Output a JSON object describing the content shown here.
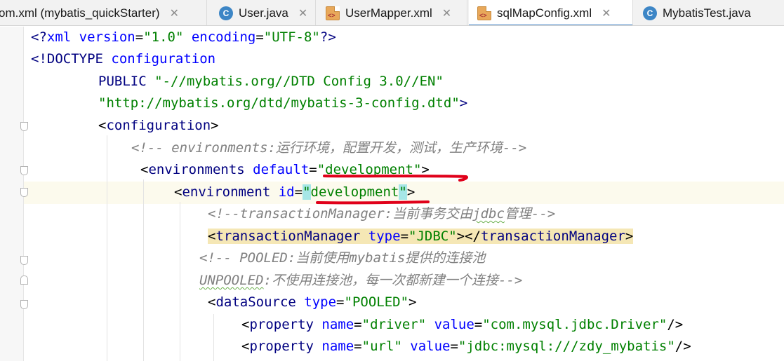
{
  "tabs": [
    {
      "label": "om.xml (mybatis_quickStarter)",
      "icon": "none",
      "active": false
    },
    {
      "label": "User.java",
      "icon": "java-class-icon",
      "active": false
    },
    {
      "label": "UserMapper.xml",
      "icon": "xml-file-icon",
      "active": false
    },
    {
      "label": "sqlMapConfig.xml",
      "icon": "xml-file-icon",
      "active": true
    },
    {
      "label": "MybatisTest.java",
      "icon": "java-class-icon",
      "active": false
    }
  ],
  "close_glyph": "✕",
  "code": {
    "l1": {
      "p1": "<?",
      "p2": "xml",
      "p3": " version",
      "p4": "=",
      "p5": "\"1.0\"",
      "p6": " encoding",
      "p7": "=",
      "p8": "\"UTF-8\"",
      "p9": "?>"
    },
    "l2": {
      "p1": "<!DOCTYPE ",
      "p2": "configuration"
    },
    "l3": {
      "p1": "PUBLIC ",
      "p2": "\"-//mybatis.org//DTD Config 3.0//EN\""
    },
    "l4": {
      "p1": "\"http://mybatis.org/dtd/mybatis-3-config.dtd\"",
      "p2": ">"
    },
    "l5": {
      "p1": "<",
      "p2": "configuration",
      "p3": ">"
    },
    "l6": {
      "p1": "<!-- environments:",
      "p2": "运行环境，配置开发，测试，生产环境",
      "p3": "-->"
    },
    "l7": {
      "p1": "<",
      "p2": "environments",
      "p3": " default",
      "p4": "=",
      "p5": "\"development\"",
      "p6": ">"
    },
    "l8": {
      "p1": "<",
      "p2": "environment",
      "p3": " id",
      "p4": "=",
      "p5": "\"",
      "p6": "development",
      "p7": "\"",
      "p8": ">"
    },
    "l9": {
      "p1": "<!--transactionManager:",
      "p2": "当前事务交由",
      "p3": "jdbc",
      "p4": "管理",
      "p5": "-->"
    },
    "l10": {
      "p1": "<",
      "p2": "transactionManager",
      "p3": " type",
      "p4": "=",
      "p5": "\"JDBC\"",
      "p6": "></",
      "p7": "transactionManager",
      "p8": ">"
    },
    "l11": {
      "p1": "<!-- POOLED:",
      "p2": "当前使用",
      "p3": "mybatis",
      "p4": "提供的连接池"
    },
    "l12": {
      "p1": "UNPOOLED",
      "p2": ":",
      "p3": "不使用连接池，每一次都新建一个连接",
      "p4": "-->"
    },
    "l13": {
      "p1": "<",
      "p2": "dataSource",
      "p3": " type",
      "p4": "=",
      "p5": "\"POOLED\"",
      "p6": ">"
    },
    "l14": {
      "p1": "<",
      "p2": "property",
      "p3": " name",
      "p4": "=",
      "p5": "\"driver\"",
      "p6": " value",
      "p7": "=",
      "p8": "\"com.mysql.jdbc.Driver\"",
      "p9": "/>"
    },
    "l15": {
      "p1": "<",
      "p2": "property",
      "p3": " name",
      "p4": "=",
      "p5": "\"url\"",
      "p6": " value",
      "p7": "=",
      "p8": "\"jdbc:mysql:///zdy_mybatis\"",
      "p9": "/>"
    }
  },
  "colors": {
    "tag": "#000080",
    "attribute": "#0000ff",
    "value": "#008000",
    "comment": "#808080",
    "annotation": "#e0001a",
    "active_tab_underline": "#4a88c7"
  }
}
